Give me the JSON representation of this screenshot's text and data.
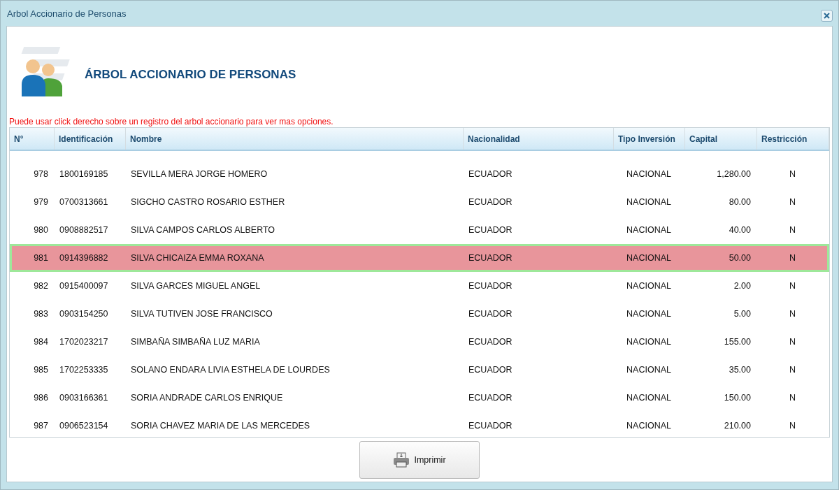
{
  "window": {
    "title": "Arbol Accionario de Personas"
  },
  "heading": "ÁRBOL ACCIONARIO DE PERSONAS",
  "hint": "Puede usar click derecho sobre un registro del arbol accionario para ver mas opciones.",
  "table": {
    "columns": [
      "N°",
      "Identificación",
      "Nombre",
      "Nacionalidad",
      "Tipo Inversión",
      "Capital",
      "Restricción"
    ],
    "rows": [
      {
        "cells": [
          "978",
          "1800169185",
          "SEVILLA MERA JORGE HOMERO",
          "ECUADOR",
          "NACIONAL",
          "1,280.00",
          "N"
        ],
        "selected": false
      },
      {
        "cells": [
          "979",
          "0700313661",
          "SIGCHO CASTRO ROSARIO ESTHER",
          "ECUADOR",
          "NACIONAL",
          "80.00",
          "N"
        ],
        "selected": false
      },
      {
        "cells": [
          "980",
          "0908882517",
          "SILVA CAMPOS CARLOS ALBERTO",
          "ECUADOR",
          "NACIONAL",
          "40.00",
          "N"
        ],
        "selected": false
      },
      {
        "cells": [
          "981",
          "0914396882",
          "SILVA CHICAIZA EMMA ROXANA",
          "ECUADOR",
          "NACIONAL",
          "50.00",
          "N"
        ],
        "selected": true
      },
      {
        "cells": [
          "982",
          "0915400097",
          "SILVA GARCES MIGUEL ANGEL",
          "ECUADOR",
          "NACIONAL",
          "2.00",
          "N"
        ],
        "selected": false
      },
      {
        "cells": [
          "983",
          "0903154250",
          "SILVA TUTIVEN JOSE FRANCISCO",
          "ECUADOR",
          "NACIONAL",
          "5.00",
          "N"
        ],
        "selected": false
      },
      {
        "cells": [
          "984",
          "1702023217",
          "SIMBAÑA SIMBAÑA LUZ MARIA",
          "ECUADOR",
          "NACIONAL",
          "155.00",
          "N"
        ],
        "selected": false
      },
      {
        "cells": [
          "985",
          "1702253335",
          "SOLANO ENDARA LIVIA ESTHELA DE LOURDES",
          "ECUADOR",
          "NACIONAL",
          "35.00",
          "N"
        ],
        "selected": false
      },
      {
        "cells": [
          "986",
          "0903166361",
          "SORIA ANDRADE CARLOS ENRIQUE",
          "ECUADOR",
          "NACIONAL",
          "150.00",
          "N"
        ],
        "selected": false
      },
      {
        "cells": [
          "987",
          "0906523154",
          "SORIA CHAVEZ MARIA DE LAS MERCEDES",
          "ECUADOR",
          "NACIONAL",
          "210.00",
          "N"
        ],
        "selected": false
      }
    ]
  },
  "button": "Imprimir"
}
